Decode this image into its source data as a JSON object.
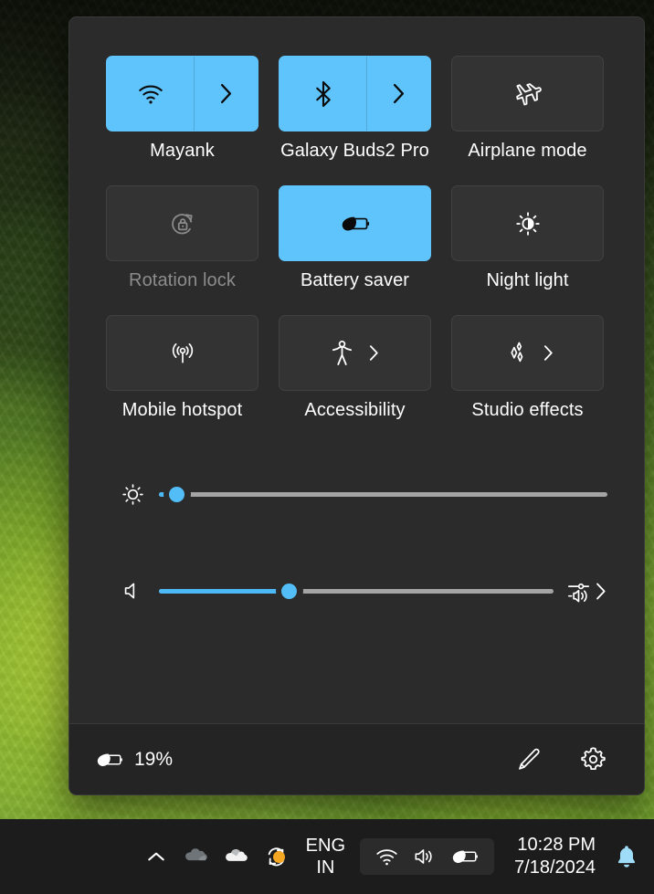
{
  "panel": {
    "name": "quick-settings",
    "accent_color": "#5fc4fb",
    "background_color": "#2b2b2b",
    "tiles": [
      {
        "label": "Mayank",
        "icon": "wifi-icon",
        "state": "on",
        "style": "split",
        "chevron": true
      },
      {
        "label": "Galaxy Buds2 Pro",
        "icon": "bluetooth-icon",
        "state": "on",
        "style": "split",
        "chevron": true
      },
      {
        "label": "Airplane mode",
        "icon": "airplane-icon",
        "state": "off",
        "style": "plain",
        "chevron": false
      },
      {
        "label": "Rotation lock",
        "icon": "rotation-lock-icon",
        "state": "disabled",
        "style": "plain",
        "chevron": false
      },
      {
        "label": "Battery saver",
        "icon": "battery-saver-icon",
        "state": "on",
        "style": "plain",
        "chevron": false
      },
      {
        "label": "Night light",
        "icon": "night-light-icon",
        "state": "off",
        "style": "plain",
        "chevron": false
      },
      {
        "label": "Mobile hotspot",
        "icon": "mobile-hotspot-icon",
        "state": "off",
        "style": "plain",
        "chevron": false
      },
      {
        "label": "Accessibility",
        "icon": "accessibility-icon",
        "state": "off",
        "style": "inline",
        "chevron": true
      },
      {
        "label": "Studio effects",
        "icon": "studio-effects-icon",
        "state": "off",
        "style": "inline",
        "chevron": true
      }
    ],
    "sliders": {
      "brightness": {
        "name": "brightness-slider",
        "icon": "brightness-icon",
        "value": 4,
        "min": 0,
        "max": 100
      },
      "volume": {
        "name": "volume-slider",
        "icon": "speaker-icon",
        "value": 33,
        "min": 0,
        "max": 100,
        "trailing_icon": "audio-mixer-icon",
        "trailing_chevron": true
      }
    },
    "footer": {
      "battery_icon": "battery-saver-icon",
      "battery_percent": "19%",
      "edit_label": "edit-quick-settings",
      "settings_label": "open-settings"
    }
  },
  "taskbar": {
    "tray_overflow_icon": "chevron-up-icon",
    "tray_icons": [
      "onedrive-personal-icon",
      "onedrive-work-icon",
      "sync-icon"
    ],
    "language": {
      "line1": "ENG",
      "line2": "IN"
    },
    "status_pill_icons": [
      "wifi-icon",
      "volume-icon",
      "battery-saver-icon"
    ],
    "clock": {
      "time": "10:28 PM",
      "date": "7/18/2024"
    },
    "notifications_icon": "bell-icon",
    "notifications_color": "#9fdcf7"
  }
}
